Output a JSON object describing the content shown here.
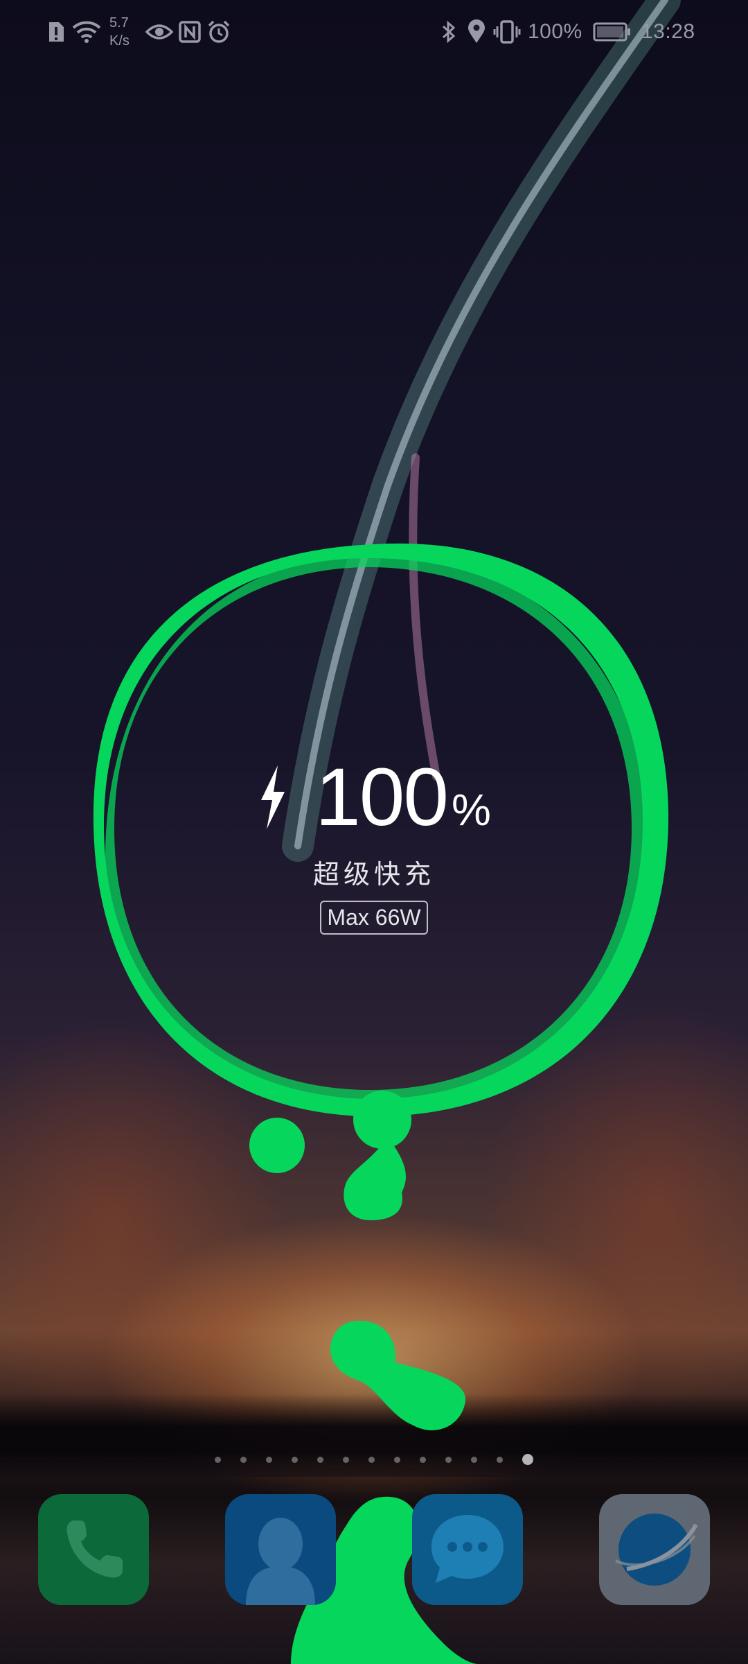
{
  "status_bar": {
    "net_speed_value": "5.7",
    "net_speed_unit": "K/s",
    "battery_percent": "100%",
    "time": "13:28",
    "left_icons": [
      "alert-icon",
      "wifi-icon",
      "eye-icon",
      "nfc-icon",
      "alarm-icon"
    ],
    "right_icons": [
      "bluetooth-icon",
      "location-icon",
      "vibrate-icon",
      "battery-icon"
    ]
  },
  "charging": {
    "level": "100",
    "unit": "%",
    "mode_label": "超级快充",
    "max_power": "Max 66W",
    "accent_color": "#07d65c",
    "icon": "lightning-bolt-icon"
  },
  "home": {
    "page_count": 13,
    "active_page": 13,
    "dock_apps": [
      {
        "name": "phone",
        "icon": "phone-icon",
        "color": "#0c6a3a"
      },
      {
        "name": "contacts",
        "icon": "contacts-icon",
        "color": "#0a4a7e"
      },
      {
        "name": "messages",
        "icon": "messages-icon",
        "color": "#0b5a8a"
      },
      {
        "name": "browser",
        "icon": "browser-icon",
        "color": "#5f6772"
      }
    ]
  }
}
